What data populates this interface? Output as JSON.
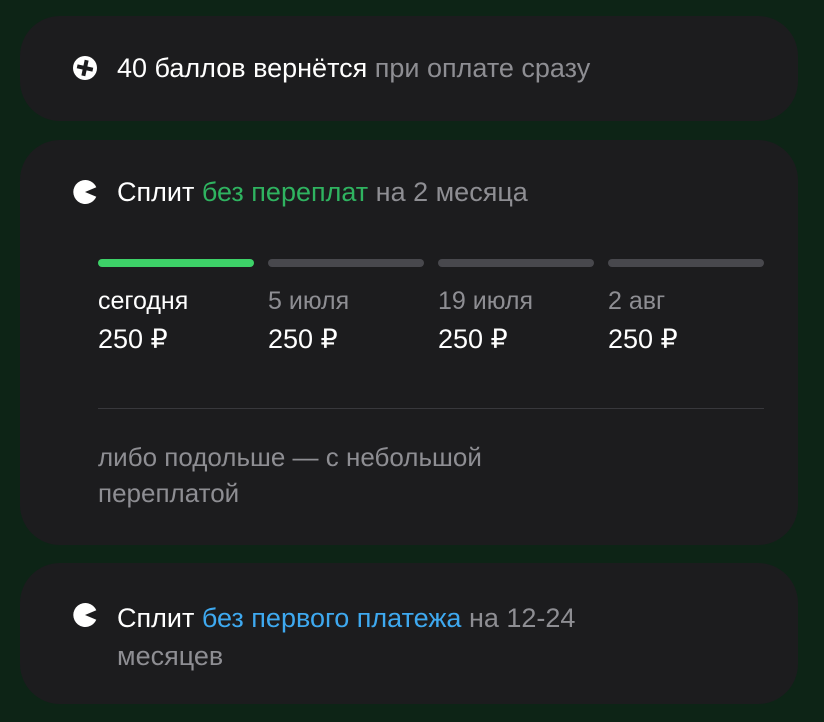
{
  "points_card": {
    "icon": "points-icon",
    "bold_text": "40 баллов вернётся",
    "rest_text": "при оплате сразу"
  },
  "split_card": {
    "icon": "split-icon",
    "title_prefix": "Сплит",
    "title_highlight": "без переплат",
    "title_suffix": "на 2 месяца",
    "highlight_color": "#2fb360",
    "progress_segments": [
      {
        "state": "paid",
        "color": "#3dd168"
      },
      {
        "state": "pending",
        "color": "#48484d"
      },
      {
        "state": "pending",
        "color": "#48484d"
      },
      {
        "state": "pending",
        "color": "#48484d"
      }
    ],
    "payments": [
      {
        "date": "сегодня",
        "amount": "250 ₽"
      },
      {
        "date": "5 июля",
        "amount": "250 ₽"
      },
      {
        "date": "19 июля",
        "amount": "250 ₽"
      },
      {
        "date": "2 авг",
        "amount": "250 ₽"
      }
    ],
    "alternative_text": "либо подольше — с небольшой переплатой"
  },
  "split_card_2": {
    "icon": "split-icon",
    "title_prefix": "Сплит",
    "title_highlight": "без первого платежа",
    "title_suffix": "на 12-24 месяцев",
    "highlight_color": "#3ea9f0"
  }
}
